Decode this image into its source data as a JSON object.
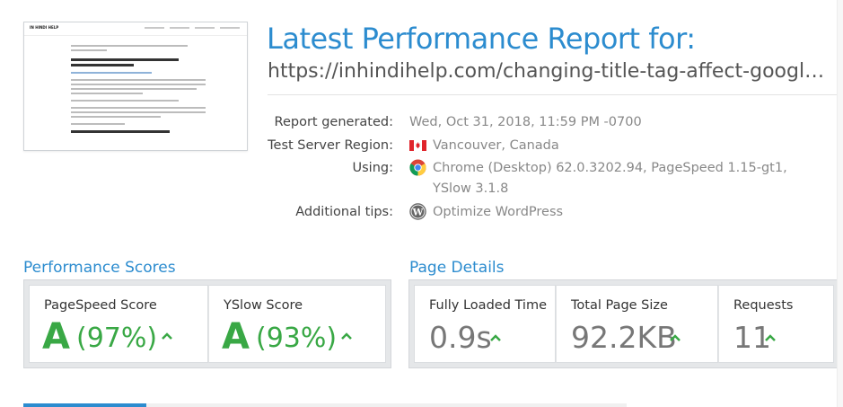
{
  "thumbnail": {
    "site_name": "IN HINDI HELP",
    "heading": "???? Blog Post Title Tag ????? ?? Google Ranking ?????????? ??? ??"
  },
  "report": {
    "title": "Latest Performance Report for:",
    "url": "https://inhindihelp.com/changing-title-tag-affect-google…"
  },
  "meta": {
    "generated_label": "Report generated:",
    "generated_value": "Wed, Oct 31, 2018, 11:59 PM -0700",
    "region_label": "Test Server Region:",
    "region_value": "Vancouver, Canada",
    "using_label": "Using:",
    "using_line1": "Chrome (Desktop) 62.0.3202.94, PageSpeed 1.15-gt1,",
    "using_line2": "YSlow 3.1.8",
    "tips_label": "Additional tips:",
    "tips_value": "Optimize WordPress",
    "icons": {
      "region": "canada-flag-icon",
      "using": "chrome-icon",
      "tips": "wordpress-icon"
    }
  },
  "performance": {
    "title": "Performance Scores",
    "pagespeed_label": "PageSpeed Score",
    "pagespeed_grade": "A",
    "pagespeed_pct": "(97%)",
    "yslow_label": "YSlow Score",
    "yslow_grade": "A",
    "yslow_pct": "(93%)"
  },
  "details": {
    "title": "Page Details",
    "load_label": "Fully Loaded Time",
    "load_value": "0.9s",
    "size_label": "Total Page Size",
    "size_value": "92.2KB",
    "requests_label": "Requests",
    "requests_value": "11"
  },
  "colors": {
    "accent": "#2c8ccf",
    "good": "#39a845"
  }
}
